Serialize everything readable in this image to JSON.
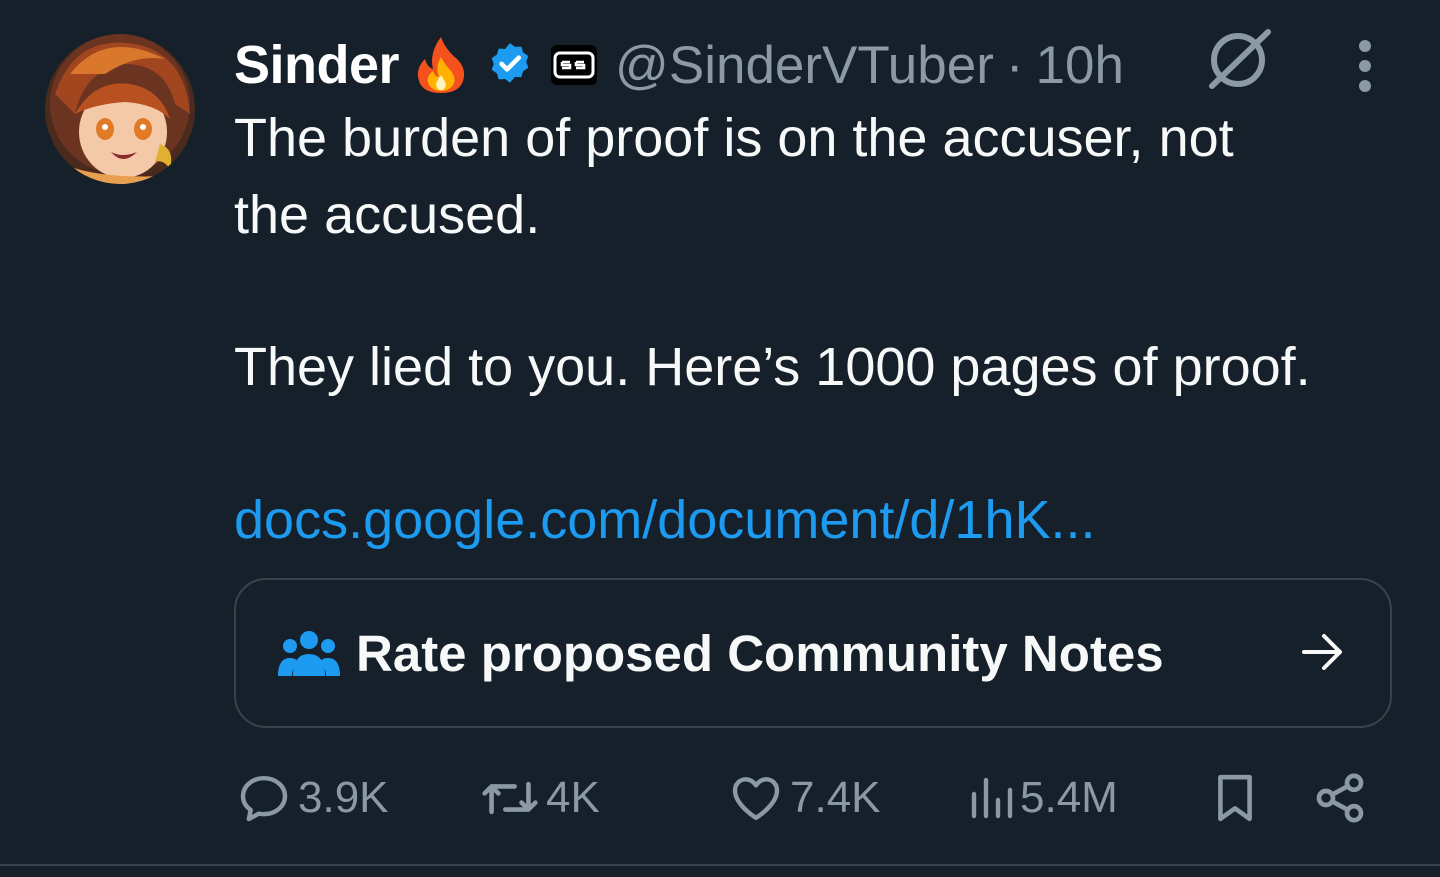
{
  "author": {
    "display_name": "Sinder",
    "handle": "@SinderVTuber",
    "separator": "·",
    "time": "10h"
  },
  "icons": {
    "fire": "fire-emoji-icon",
    "verified": "verified-badge-icon",
    "affiliate": "affiliate-badge-icon",
    "grok": "grok-icon",
    "more": "more-vertical-icon"
  },
  "tweet": {
    "line1": "The burden of proof is on the accuser, not",
    "line2": "the accused.",
    "line3": "They lied to you. Here’s 1000 pages of proof.",
    "link": "docs.google.com/document/d/1hK..."
  },
  "community_notes": {
    "label": "Rate proposed Community Notes"
  },
  "actions": {
    "replies": "3.9K",
    "reposts": "4K",
    "likes": "7.4K",
    "views": "5.4M"
  },
  "colors": {
    "background": "#15202b",
    "text": "#f7f9f9",
    "secondary": "#8b98a5",
    "accent": "#1d9bf0",
    "border": "#38444d"
  }
}
